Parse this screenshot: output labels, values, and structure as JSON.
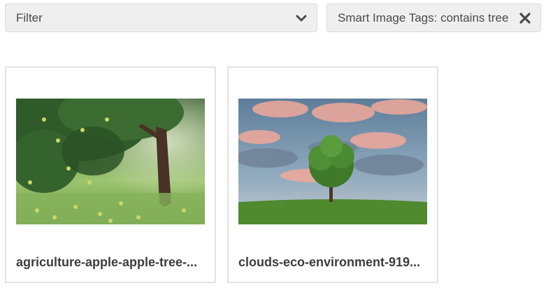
{
  "filter": {
    "label": "Filter",
    "icon": "chevron-down-icon"
  },
  "active_tag": {
    "label": "Smart Image Tags: contains tree",
    "icon": "close-icon"
  },
  "results": [
    {
      "title": "agriculture-apple-apple-tree-...",
      "thumbnail": "apple-tree-orchard"
    },
    {
      "title": "clouds-eco-environment-919...",
      "thumbnail": "lone-tree-sky"
    }
  ]
}
